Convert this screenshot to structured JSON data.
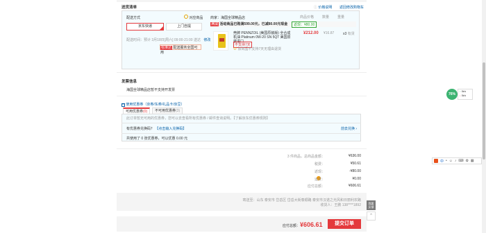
{
  "shipping": {
    "title": "送货清单",
    "price_link": "价格说明",
    "back_cart": "返回修改购物车",
    "delivery_label": "配送方式",
    "jd_express": "京东快递",
    "pickup": "上门自提",
    "delivery_time": "配送时间：预计 3月18日[周六] 09:00-21:00 送达",
    "modify": "修改",
    "jd_tag": "标准达",
    "install_tip": "配送服务全国可用",
    "check_goods": "对应商品",
    "store_prefix": "商家：",
    "store_name": "海国全球精品店",
    "col_price": "商品价格",
    "col_qty": "数量",
    "col_weight": "重量",
    "promo_tag": "满减",
    "promo_text": "活动商品已购满599.00元，已减80.00元现金",
    "promo_badge": "返现：¥80.00",
    "product_name": "壳牌 PENNZOIL (美国原装版) 全合成机油 Platinum 0W-20 SN 5QT 美国原装进口",
    "product_price": "¥212.00",
    "product_weight": "¥16.87",
    "product_qty": "x3",
    "product_stock": "有货",
    "product_tag1": "不支持7天",
    "product_tag2": "该商品不支持7天无理由退货"
  },
  "invoice": {
    "title": "发票信息",
    "text": "海国全球精品店暂不支持开发票"
  },
  "coupon": {
    "toggle": "使用优惠券（京券/东券/礼品卡/京豆）",
    "tab_available": "可用优惠券",
    "tab_available_count": "(0)",
    "tab_unavailable": "不可用优惠券",
    "tab_unavailable_count": "(3)",
    "notice": "此订单暂无可用的优惠券，您可以去查看所有优惠券 / 邮件查询说明。【了解京东优惠券规则】",
    "exchange_label": "有优惠券兑换码？",
    "exchange_link": "【点击输入兑换码】",
    "manage": "前去兑换 ›",
    "summary": "共使用了 0 张优惠券，可以优惠 0.00 元"
  },
  "totals": {
    "items_label": "3 件商品，总商品金额：",
    "items_value": "¥636.00",
    "tax_label": "税费：",
    "tax_value": "¥50.61",
    "rebate_label": "返现：",
    "rebate_value": "-¥80.00",
    "shipping_label": "运费：",
    "shipping_value": "¥0.00",
    "pay_label": "应付总额：",
    "pay_value": "¥606.61"
  },
  "footer": {
    "address": "寄送至：山东 泰安市 岱岳区 岱岳大街泰顺路 泰安市汉诺之光风和日丽利农路",
    "recipient": "收货人：王鹏 138****1892",
    "total_label": "应付总额：",
    "total_value": "¥606.61",
    "submit": "提交订单"
  },
  "side": {
    "speed": "76%",
    "up": "0k/s",
    "down": "0k/s",
    "help_line1": "我要",
    "help_line2": "反馈"
  },
  "colors": {
    "accent": "#e4393c",
    "link": "#005ea7"
  }
}
